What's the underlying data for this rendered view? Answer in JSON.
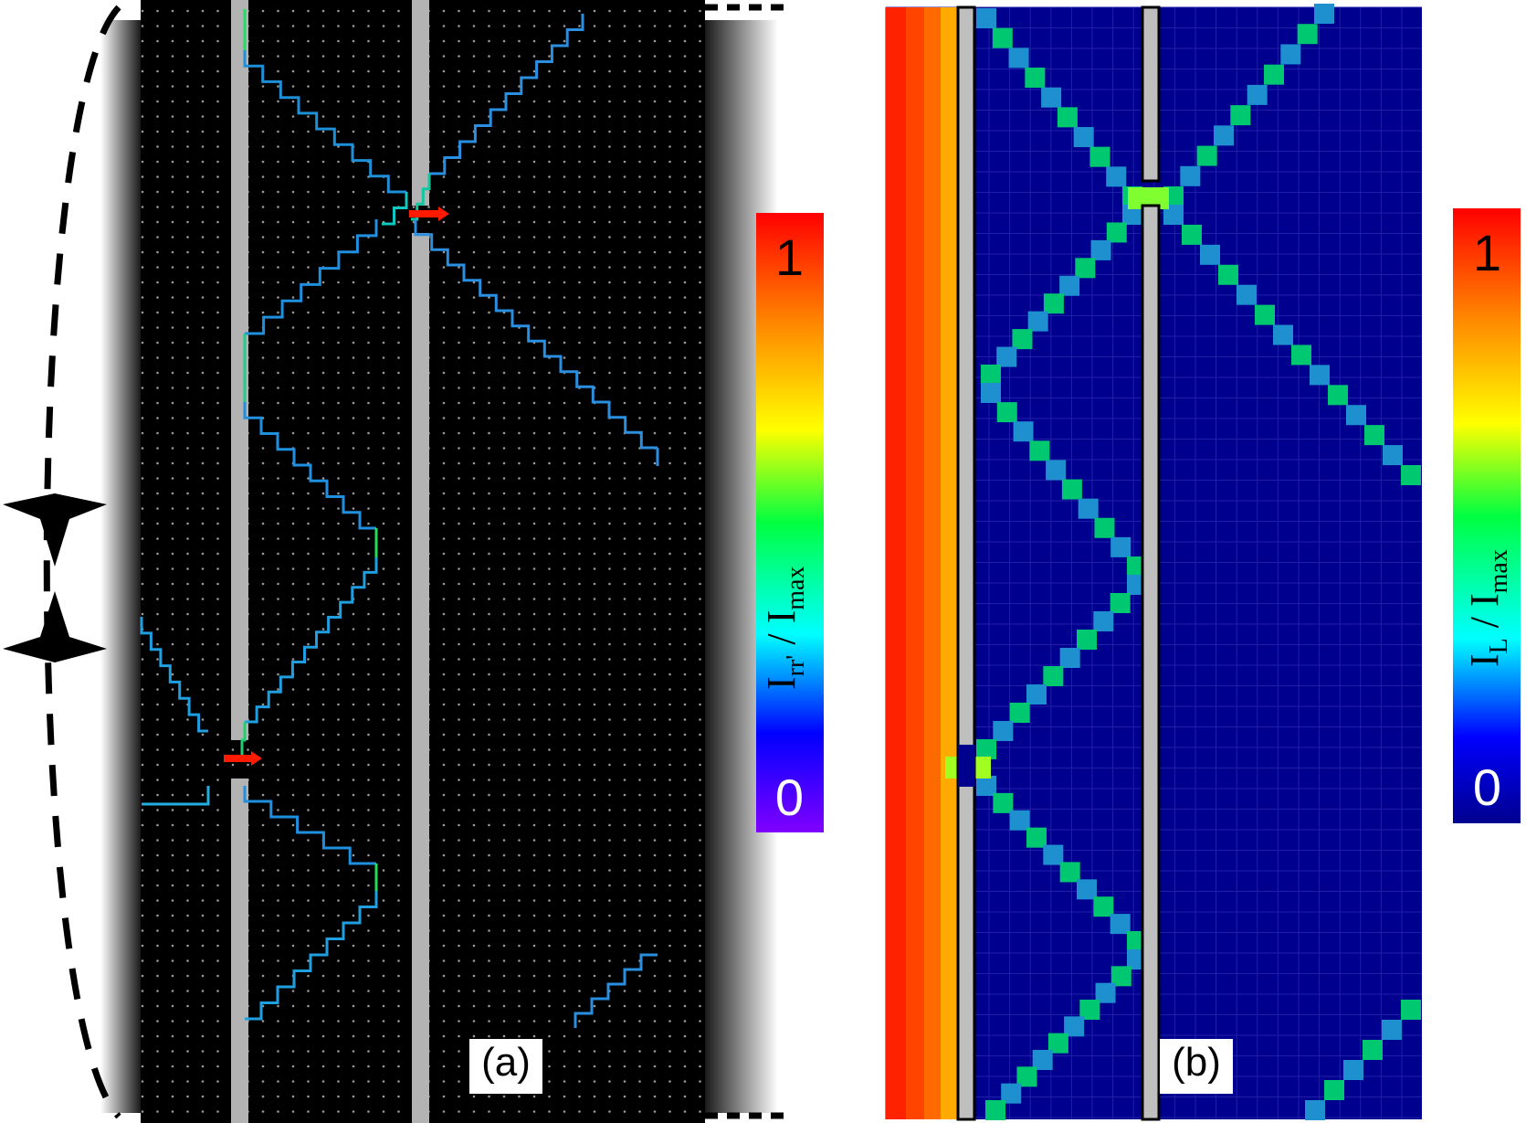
{
  "panel_a": {
    "label": "(a)",
    "colorbar": {
      "max_label": "1",
      "min_label": "0",
      "title_main": "I",
      "title_sub": "rr'",
      "title_sep": " / I",
      "title_sub2": "max"
    },
    "colors": {
      "background": "#000000",
      "barrier": "#b3b3b3",
      "dot": "#9a9a9a",
      "current_hot": "#ff1a00",
      "arrow": "#000000"
    }
  },
  "panel_b": {
    "label": "(b)",
    "colorbar": {
      "max_label": "1",
      "min_label": "0",
      "title_main": "I",
      "title_sub": "L",
      "title_sep": " / I",
      "title_sub2": "max"
    },
    "colors": {
      "background": "#00008f",
      "barrier": "#bfbfbf"
    }
  }
}
